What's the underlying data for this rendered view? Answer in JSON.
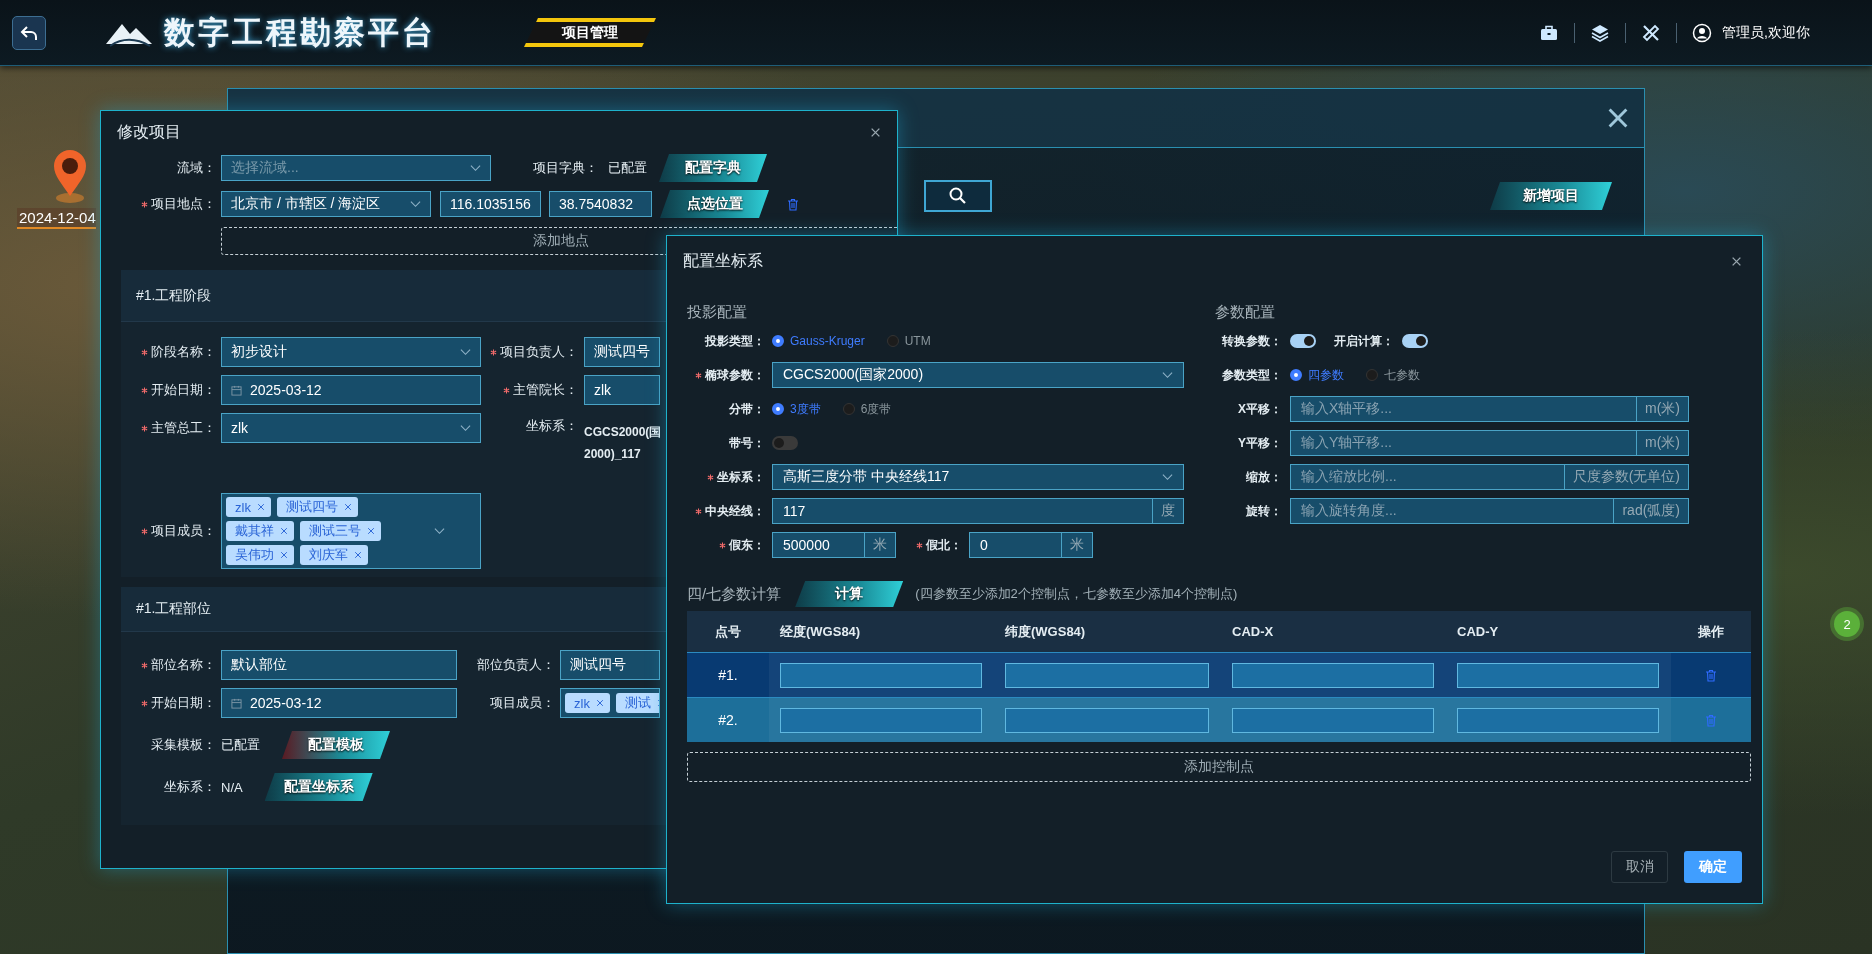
{
  "header": {
    "title": "数字工程勘察平台",
    "nav_tab": {
      "label": "项目管理",
      "selected": true
    },
    "user": "管理员,欢迎你"
  },
  "map": {
    "marker_date": "2024-12-04",
    "cluster_count": "2"
  },
  "panel": {
    "add_button": "新增项目"
  },
  "edit_dialog": {
    "title": "修改项目",
    "top_rows": [
      {
        "kind": "select_config",
        "label": "流域：",
        "required": false,
        "placeholder": "选择流域...",
        "side": {
          "label": "项目字典：",
          "status": "已配置",
          "button": "配置字典"
        }
      },
      {
        "kind": "location",
        "label": "项目地点：",
        "required": true,
        "region": "北京市 / 市辖区 / 海淀区",
        "longitude": "116.1035156",
        "latitude": "38.7540832",
        "button": "点选位置"
      }
    ],
    "add_location": "添加地点",
    "sections": [
      {
        "heading": "#1.工程阶段",
        "rows": [
          [
            {
              "kind": "select",
              "label": "阶段名称：",
              "required": true,
              "value": "初步设计"
            },
            {
              "kind": "select",
              "label": "项目负责人：",
              "required": true,
              "value": "测试四号"
            }
          ],
          [
            {
              "kind": "date",
              "label": "开始日期：",
              "required": true,
              "value": "2025-03-12"
            },
            {
              "kind": "select",
              "label": "主管院长：",
              "required": true,
              "value": "zlk"
            }
          ],
          [
            {
              "kind": "select",
              "label": "主管总工：",
              "required": true,
              "value": "zlk"
            },
            {
              "kind": "info",
              "label": "坐标系：",
              "lines": [
                "CGCS2000(国",
                "2000)_117"
              ]
            }
          ],
          [
            {
              "kind": "tags",
              "label": "项目成员：",
              "required": true,
              "tags": [
                "zlk",
                "测试四号",
                "戴其祥",
                "测试三号",
                "吴伟功",
                "刘庆军"
              ]
            }
          ]
        ]
      },
      {
        "heading": "#1.工程部位",
        "rows": [
          [
            {
              "kind": "input",
              "label": "部位名称：",
              "required": true,
              "value": "默认部位"
            },
            {
              "kind": "select",
              "label": "部位负责人：",
              "required": false,
              "value": "测试四号"
            }
          ],
          [
            {
              "kind": "date",
              "label": "开始日期：",
              "required": true,
              "value": "2025-03-12"
            },
            {
              "kind": "tags",
              "label": "项目成员：",
              "required": false,
              "tags": [
                "zlk",
                "测试"
              ]
            }
          ],
          [
            {
              "kind": "config",
              "label": "采集模板：",
              "status": "已配置",
              "button": "配置模板",
              "warning": true
            }
          ],
          [
            {
              "kind": "config",
              "label": "坐标系：",
              "status": "N/A",
              "button": "配置坐标系",
              "warning": false
            }
          ]
        ]
      }
    ]
  },
  "coord_dialog": {
    "title": "配置坐标系",
    "projection": {
      "heading": "投影配置",
      "rows": [
        {
          "kind": "radio",
          "label": "投影类型：",
          "required": false,
          "options": [
            {
              "label": "Gauss-Kruger",
              "selected": true
            },
            {
              "label": "UTM",
              "selected": false
            }
          ]
        },
        {
          "kind": "select",
          "label": "椭球参数：",
          "required": true,
          "value": "CGCS2000(国家2000)"
        },
        {
          "kind": "radio",
          "label": "分带：",
          "required": false,
          "options": [
            {
              "label": "3度带",
              "selected": true
            },
            {
              "label": "6度带",
              "selected": false
            }
          ]
        },
        {
          "kind": "switch",
          "label": "带号：",
          "on": false
        },
        {
          "kind": "select",
          "label": "坐标系：",
          "required": true,
          "value": "高斯三度分带 中央经线117"
        },
        {
          "kind": "input",
          "label": "中央经线：",
          "required": true,
          "value": "117",
          "unit": "度"
        },
        {
          "kind": "pair",
          "items": [
            {
              "label": "假东：",
              "required": true,
              "value": "500000",
              "unit": "米"
            },
            {
              "label": "假北：",
              "required": true,
              "value": "0",
              "unit": "米"
            }
          ]
        }
      ]
    },
    "params": {
      "heading": "参数配置",
      "rows": [
        {
          "kind": "switches",
          "items": [
            {
              "label": "转换参数：",
              "on": true
            },
            {
              "label": "开启计算：",
              "on": true
            }
          ]
        },
        {
          "kind": "radio",
          "label": "参数类型：",
          "required": false,
          "options": [
            {
              "label": "四参数",
              "selected": true
            },
            {
              "label": "七参数",
              "selected": false
            }
          ]
        },
        {
          "kind": "input",
          "label": "X平移：",
          "required": false,
          "placeholder": "输入X轴平移...",
          "unit": "m(米)"
        },
        {
          "kind": "input",
          "label": "Y平移：",
          "required": false,
          "placeholder": "输入Y轴平移...",
          "unit": "m(米)"
        },
        {
          "kind": "input",
          "label": "缩放：",
          "required": false,
          "placeholder": "输入缩放比例...",
          "unit": "尺度参数(无单位)"
        },
        {
          "kind": "input",
          "label": "旋转：",
          "required": false,
          "placeholder": "输入旋转角度...",
          "unit": "rad(弧度)"
        }
      ]
    },
    "calc": {
      "heading": "四/七参数计算",
      "button": "计算",
      "hint": "(四参数至少添加2个控制点，七参数至少添加4个控制点)"
    },
    "table": {
      "columns": [
        "点号",
        "经度(WGS84)",
        "纬度(WGS84)",
        "CAD-X",
        "CAD-Y",
        "操作"
      ],
      "rows": [
        {
          "id": "#1.",
          "selected": true
        },
        {
          "id": "#2.",
          "selected": false
        }
      ]
    },
    "add_point": "添加控制点",
    "buttons": {
      "cancel": "取消",
      "confirm": "确定"
    }
  }
}
